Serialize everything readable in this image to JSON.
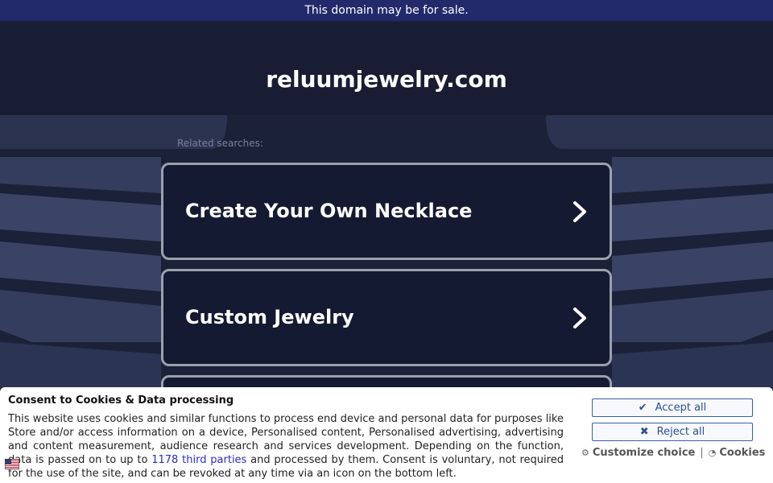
{
  "topbar": {
    "text": "This domain may be for sale."
  },
  "page": {
    "domain": "reluumjewelry.com",
    "related_label": "Related searches:"
  },
  "searches": [
    {
      "label": "Create Your Own Necklace"
    },
    {
      "label": "Custom Jewelry"
    },
    {
      "label": ""
    }
  ],
  "consent": {
    "title": "Consent to Cookies & Data processing",
    "text_before": "This website uses cookies and similar functions to process end device and personal data for purposes like Store and/or access information on a device, Personalised content, Personalised advertising, advertising and content measurement, audience research and services development. Depending on the function, data is passed on to up to ",
    "link_text": "1178 third parties",
    "text_after": " and processed by them. Consent is voluntary, not required for the use of the site, and can be revoked at any time via an icon on the bottom left.",
    "accept_label": "Accept all",
    "reject_label": "Reject all",
    "customize_label": "Customize choice",
    "separator": "|",
    "cookies_label": "Cookies",
    "accept_icon": "check-icon",
    "reject_icon": "x-icon",
    "customize_icon": "gear-icon",
    "cookies_icon": "cookie-icon"
  },
  "colors": {
    "topbar_bg": "#232a6b",
    "page_bg": "#1b2136",
    "card_bg": "#141a31",
    "card_border": "#9aa0ae",
    "button_text": "#2e4f93",
    "link": "#2a2ac8"
  }
}
